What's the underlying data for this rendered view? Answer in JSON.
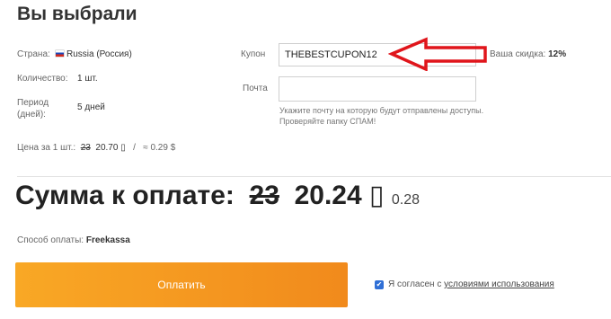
{
  "header": {
    "title": "Вы выбрали"
  },
  "details": {
    "country_label": "Страна:",
    "country_value": "Russia (Россия)",
    "country_flag_icon": "russia-flag-icon",
    "quantity_label": "Количество:",
    "quantity_value": "1 шт.",
    "period_label": "Период (дней):",
    "period_value": "5 дней",
    "unit_price_label": "Цена за 1 шт.:",
    "unit_price_old": "23",
    "unit_price_new": "20.70",
    "currency_glyph": "▯",
    "unit_price_sep": "/",
    "unit_price_approx": "≈ 0.29 $"
  },
  "coupon": {
    "label": "Купон",
    "value": "THEBESTCUPON12",
    "discount_label": "Ваша скидка:",
    "discount_value": "12%"
  },
  "email": {
    "label": "Почта",
    "value": "",
    "hint_line1": "Укажите почту на которую будут отправлены доступы.",
    "hint_line2": "Проверяйте папку СПАМ!"
  },
  "total": {
    "label": "Сумма к оплате:",
    "old": "23",
    "new": "20.24",
    "currency_glyph": "▯",
    "usd": "0.28"
  },
  "payment": {
    "method_label": "Способ оплаты:",
    "method_value": "Freekassa",
    "pay_button": "Оплатить"
  },
  "agreement": {
    "checked": true,
    "text": "Я согласен с",
    "link": "условиями использования"
  },
  "annotation": {
    "arrow_color": "#e0151b",
    "arrow_icon": "red-arrow-left-icon"
  },
  "colors": {
    "button_start": "#f9a825",
    "button_end": "#f18a1c",
    "checkbox": "#2f6fd6"
  }
}
